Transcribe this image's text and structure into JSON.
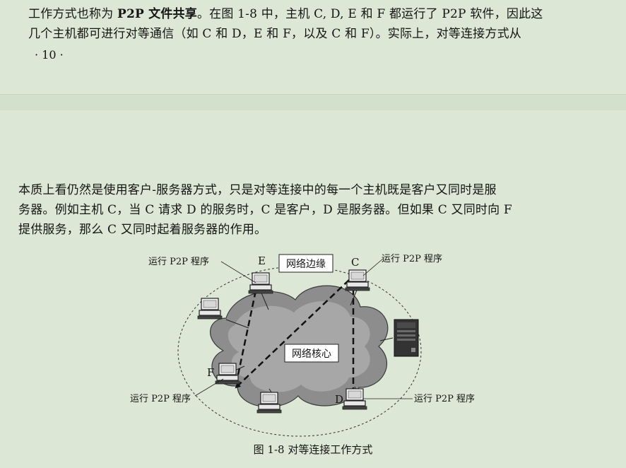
{
  "page1": {
    "paragraph_lines": [
      {
        "before": "工作方式也称为 ",
        "bold": "P2P 文件共享",
        "after": "。在图 1-8 中，主机 C, D, E 和 F 都运行了 P2P 软件，因此这"
      },
      {
        "before": "几个主机都可进行对等通信（如 C 和 D，E 和 F，以及 C 和 F）。实际上，对等连接方式从",
        "bold": "",
        "after": ""
      }
    ],
    "folio": "· 10 ·"
  },
  "page2": {
    "paragraph_lines": [
      "本质上看仍然是使用客户-服务器方式，只是对等连接中的每一个主机既是客户又同时是服",
      "务器。例如主机 C，当 C 请求 D 的服务时，C 是客户，D 是服务器。但如果 C 又同时向 F",
      "提供服务，那么 C 又同时起着服务器的作用。"
    ]
  },
  "figure": {
    "edge_label": "网络边缘",
    "core_label": "网络核心",
    "host_labels": {
      "E": "E",
      "C": "C",
      "F": "F",
      "D": "D"
    },
    "p2p_label": "运行 P2P 程序",
    "caption": "图 1-8   对等连接工作方式"
  }
}
